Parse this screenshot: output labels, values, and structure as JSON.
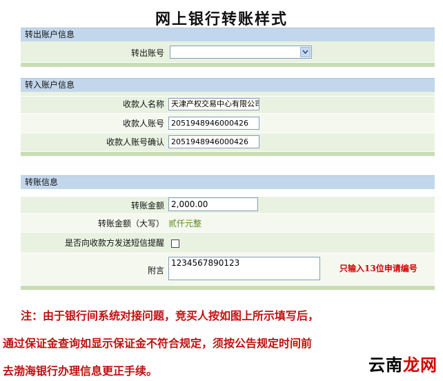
{
  "title": "网上银行转账样式",
  "out_section": {
    "header": "转出账户信息",
    "account_label": "转出账号",
    "account_value": ""
  },
  "in_section": {
    "header": "转入账户信息",
    "payee_name_label": "收款人名称",
    "payee_name_value": "天津产权交易中心有限公司",
    "payee_account_label": "收款人账号",
    "payee_account_value": "2051948946000426",
    "payee_account_confirm_label": "收款人账号确认",
    "payee_account_confirm_value": "2051948946000426"
  },
  "transfer_section": {
    "header": "转账信息",
    "amount_label": "转账金额",
    "amount_value": "2,000.00",
    "amount_words_label": "转账金额（大写）",
    "amount_words_value": "贰仟元整",
    "sms_label": "是否向收款方发送短信提醒",
    "sms_checked": false,
    "memo_label": "附言",
    "memo_value": "1234567890123",
    "memo_hint": "只输入13位申请编号"
  },
  "notes": [
    "注：由于银行间系统对接问题，竞买人按如图上所示填写后，",
    "通过保证金查询如显示保证金不符合规定，须按公告规定时间前",
    "去渤海银行办理信息更正手续。"
  ],
  "watermark": {
    "part1": "云南",
    "part2": "龙网"
  }
}
